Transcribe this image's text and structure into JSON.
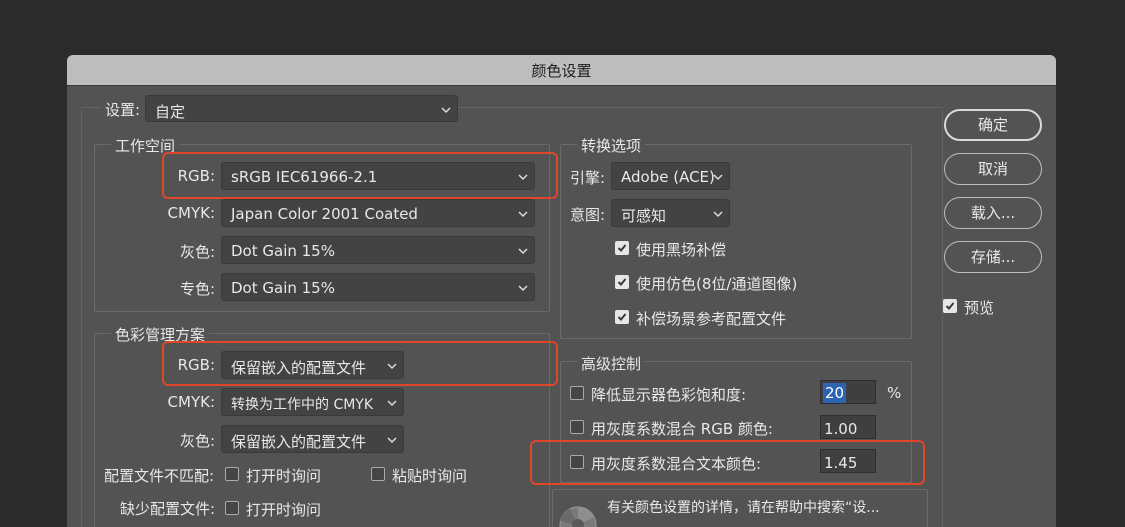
{
  "dialog": {
    "title": "颜色设置"
  },
  "settings": {
    "label": "设置:",
    "value": "自定"
  },
  "workspace": {
    "legend": "工作空间",
    "rows": [
      {
        "label": "RGB:",
        "value": "sRGB IEC61966-2.1"
      },
      {
        "label": "CMYK:",
        "value": "Japan Color 2001 Coated"
      },
      {
        "label": "灰色:",
        "value": "Dot Gain 15%"
      },
      {
        "label": "专色:",
        "value": "Dot Gain 15%"
      }
    ]
  },
  "policies": {
    "legend": "色彩管理方案",
    "rows": [
      {
        "label": "RGB:",
        "value": "保留嵌入的配置文件"
      },
      {
        "label": "CMYK:",
        "value": "转换为工作中的 CMYK"
      },
      {
        "label": "灰色:",
        "value": "保留嵌入的配置文件"
      }
    ],
    "mismatch_label": "配置文件不匹配:",
    "mismatch_open": "打开时询问",
    "mismatch_paste": "粘贴时询问",
    "missing_label": "缺少配置文件:",
    "missing_open": "打开时询问"
  },
  "conversion": {
    "legend": "转换选项",
    "engine_label": "引擎:",
    "engine_value": "Adobe (ACE)",
    "intent_label": "意图:",
    "intent_value": "可感知",
    "checks": [
      {
        "label": "使用黑场补偿",
        "checked": true
      },
      {
        "label": "使用仿色(8位/通道图像)",
        "checked": true
      },
      {
        "label": "补偿场景参考配置文件",
        "checked": true
      }
    ]
  },
  "advanced": {
    "legend": "高级控制",
    "desaturate_label": "降低显示器色彩饱和度:",
    "desaturate_value": "20",
    "desaturate_unit": "%",
    "blend_rgb_label": "用灰度系数混合 RGB 颜色:",
    "blend_rgb_value": "1.00",
    "blend_text_label": "用灰度系数混合文本颜色:",
    "blend_text_value": "1.45"
  },
  "description": {
    "text": "有关颜色设置的详情，请在帮助中搜索“设..."
  },
  "buttons": {
    "ok": "确定",
    "cancel": "取消",
    "load": "载入...",
    "save": "存储..."
  },
  "preview": {
    "label": "预览",
    "checked": true
  },
  "colors": {
    "background": "#2b2b2b",
    "dialog": "#535353",
    "titlebar": "#bdbdbd",
    "highlight": "#e0462a"
  }
}
